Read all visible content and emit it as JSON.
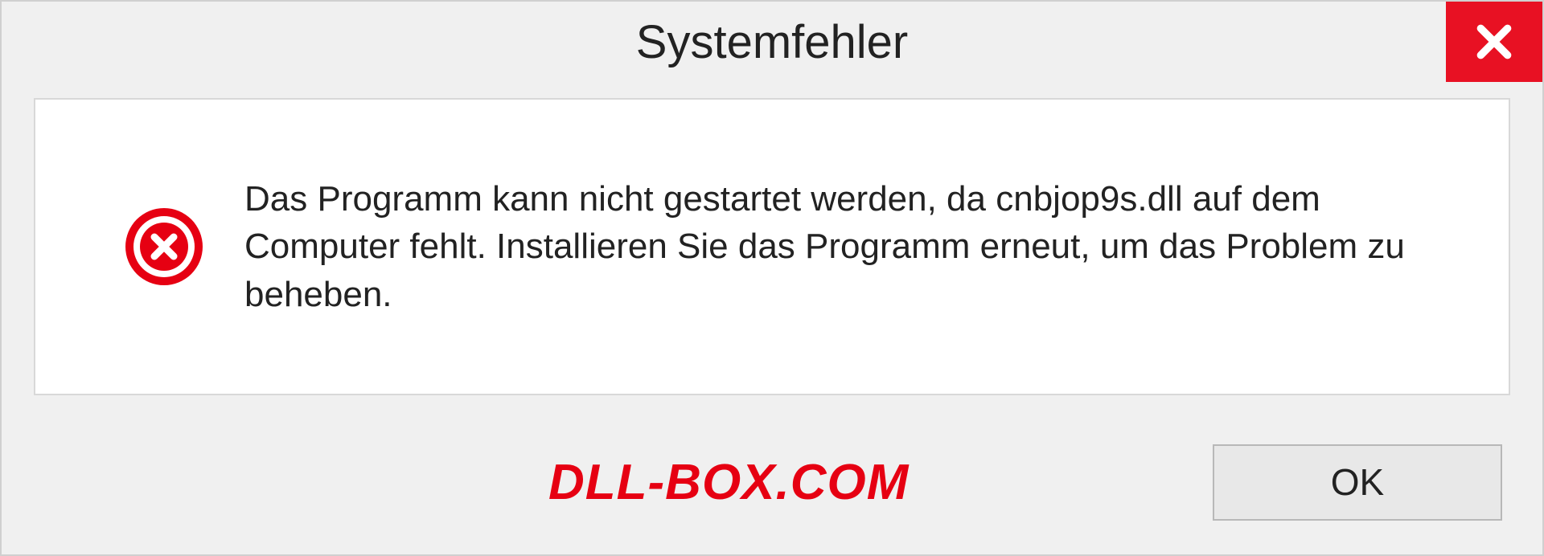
{
  "dialog": {
    "title": "Systemfehler",
    "message": "Das Programm kann nicht gestartet werden, da cnbjop9s.dll auf dem Computer fehlt. Installieren Sie das Programm erneut, um das Problem zu beheben.",
    "ok_label": "OK"
  },
  "watermark": "DLL-BOX.COM"
}
